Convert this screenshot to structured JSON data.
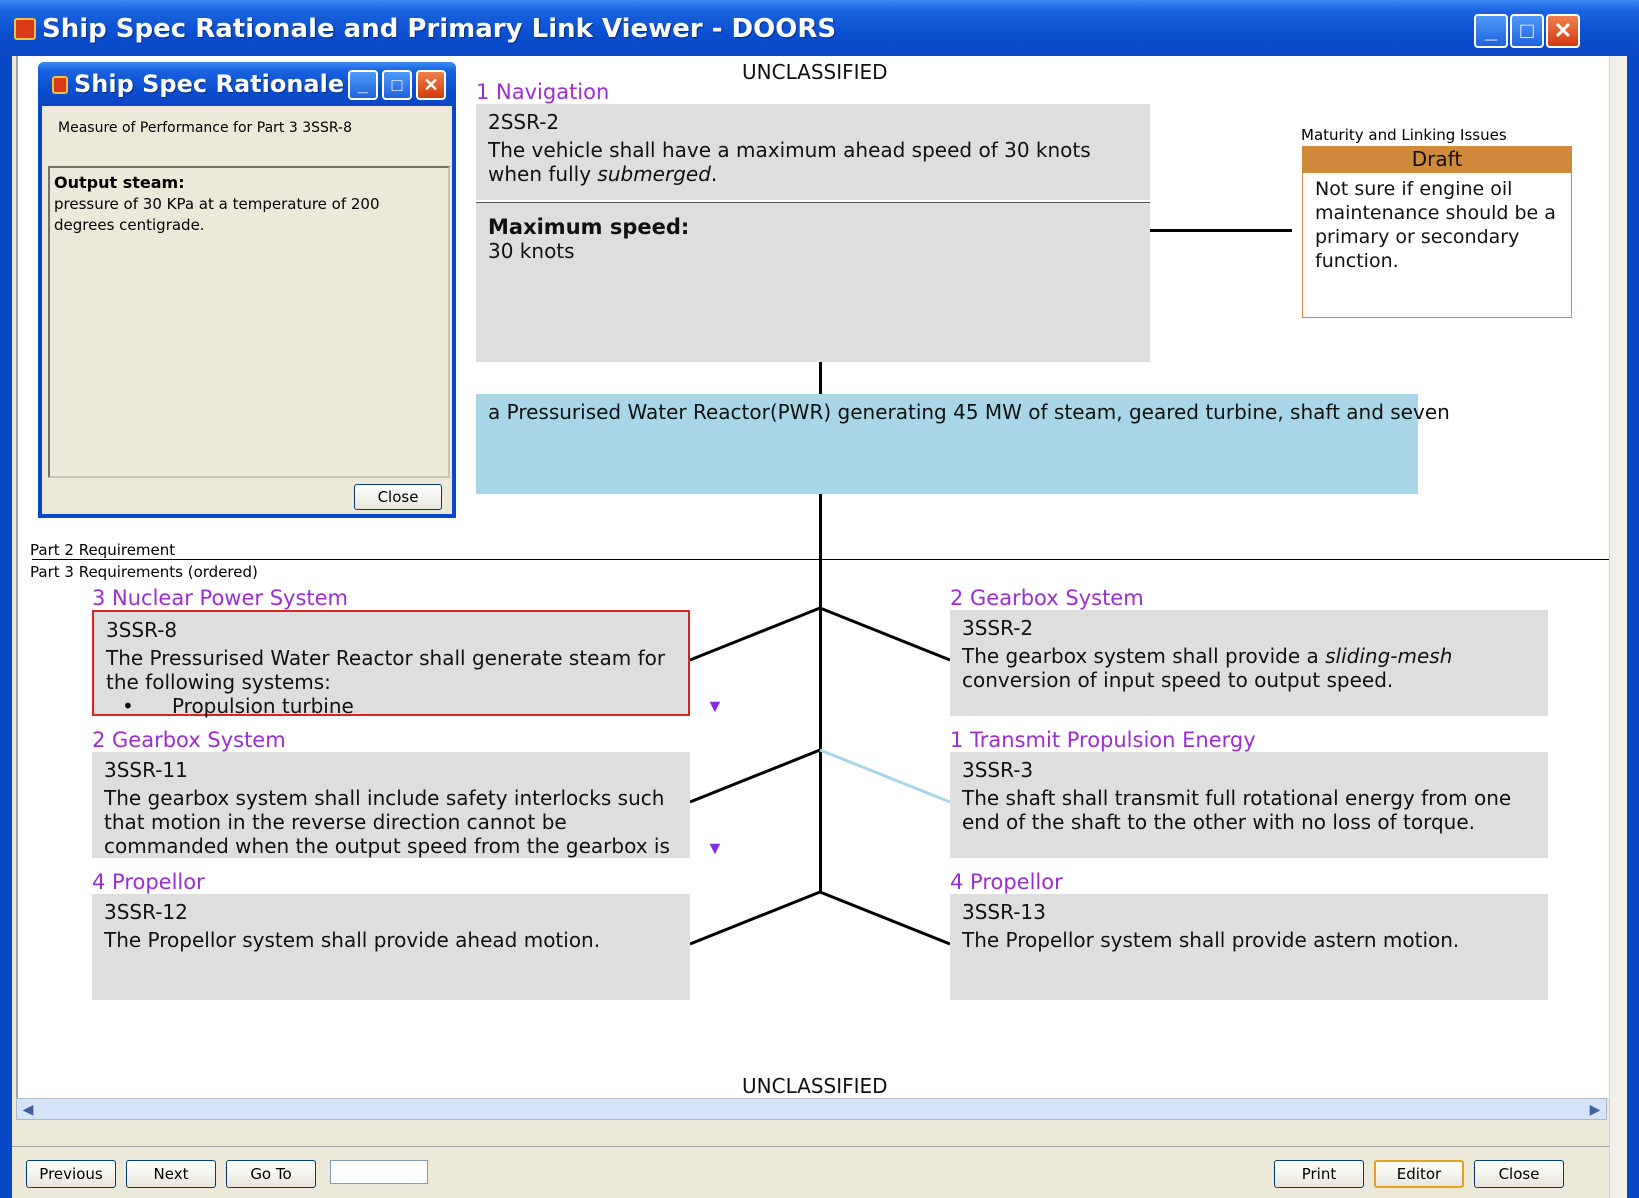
{
  "window": {
    "title": "Ship Spec Rationale and Primary Link Viewer - DOORS"
  },
  "banner": {
    "top": "UNCLASSIFIED",
    "bottom": "UNCLASSIFIED"
  },
  "top_requirement": {
    "section": "1 Navigation",
    "id": "2SSR-2",
    "text_pre": "The vehicle shall have a maximum ahead speed of 30 knots when fully ",
    "text_em": "submerged",
    "text_post": ".",
    "mop_title": "Maximum speed:",
    "mop_value": "30 knots"
  },
  "maturity": {
    "label": "Maturity and Linking Issues",
    "status": "Draft",
    "note": "Not sure if engine oil maintenance should be a primary or secondary function."
  },
  "part2": {
    "text": "a Pressurised Water Reactor(PWR) generating 45 MW of steam, geared turbine, shaft and seven"
  },
  "labels": {
    "part2": "Part 2 Requirement",
    "part3": "Part 3 Requirements (ordered)"
  },
  "left_reqs": [
    {
      "section": "3 Nuclear Power System",
      "id": "3SSR-8",
      "text": "The Pressurised Water Reactor shall generate steam for the following systems:",
      "bullet": "Propulsion turbine"
    },
    {
      "section": "2 Gearbox System",
      "id": "3SSR-11",
      "text": "The gearbox system shall include safety interlocks such that motion in the reverse direction cannot be commanded when the output speed from the gearbox is"
    },
    {
      "section": "4 Propellor",
      "id": "3SSR-12",
      "text": "The Propellor system shall provide ahead motion."
    }
  ],
  "right_reqs": [
    {
      "section": "2 Gearbox System",
      "id": "3SSR-2",
      "text_pre": "The gearbox system shall provide a ",
      "text_em": "sliding-mesh",
      "text_post": " conversion of input speed to output speed."
    },
    {
      "section": "1 Transmit Propulsion Energy",
      "id": "3SSR-3",
      "text": "The shaft shall transmit full rotational energy from one end of the shaft to the other with no loss of torque."
    },
    {
      "section": "4 Propellor",
      "id": "3SSR-13",
      "text": "The Propellor system shall provide astern motion."
    }
  ],
  "buttons": {
    "previous": "Previous",
    "next": "Next",
    "goto": "Go To",
    "print": "Print",
    "editor": "Editor",
    "close": "Close"
  },
  "goto_value": "",
  "popup": {
    "title": "Ship Spec Rationale ...",
    "caption": "Measure of Performance for Part 3 3SSR-8",
    "body_title": "Output steam:",
    "body_text": "pressure of 30 KPa at a temperature of 200 degrees centigrade.",
    "close": "Close"
  },
  "colors": {
    "titlebar": "#0a4fd0",
    "section_title": "#9b2ed3",
    "draft": "#d08a3c",
    "part2_box": "#a8d6e6",
    "selected_border": "#dd2222"
  }
}
